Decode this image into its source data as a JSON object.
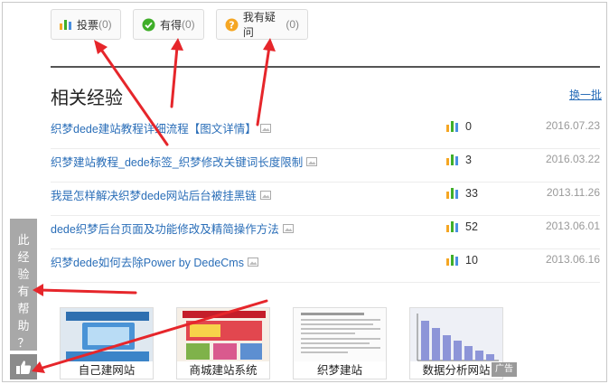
{
  "actions": [
    {
      "label": "投票",
      "count": "(0)",
      "icon": "bar-chart-icon"
    },
    {
      "label": "有得",
      "count": "(0)",
      "icon": "check-circle-icon"
    },
    {
      "label": "我有疑问",
      "count": "(0)",
      "icon": "question-circle-icon"
    }
  ],
  "related": {
    "title": "相关经验",
    "refresh_label": "换一批",
    "items": [
      {
        "title": "织梦dede建站教程详细流程【图文详情】",
        "count": "0",
        "date": "2016.07.23"
      },
      {
        "title": "织梦建站教程_dede标签_织梦修改关键词长度限制",
        "count": "3",
        "date": "2016.03.22"
      },
      {
        "title": "我是怎样解决织梦dede网站后台被挂黑链",
        "count": "33",
        "date": "2013.11.26"
      },
      {
        "title": "dede织梦后台页面及功能修改及精简操作方法",
        "count": "52",
        "date": "2013.06.01"
      },
      {
        "title": "织梦dede如何去除Power by DedeCms",
        "count": "10",
        "date": "2013.06.16"
      }
    ]
  },
  "side_panel": {
    "chars": [
      "此",
      "经",
      "验",
      "有",
      "帮",
      "助",
      "？"
    ]
  },
  "ads": {
    "cards": [
      {
        "label": "自己建网站"
      },
      {
        "label": "商城建站系统"
      },
      {
        "label": "织梦建站"
      },
      {
        "label": "数据分析网站"
      }
    ],
    "tag": "广告"
  },
  "colors": {
    "link": "#2a6eb8",
    "green": "#3fae29",
    "orange": "#f5a623",
    "annotation": "#e6262b"
  }
}
